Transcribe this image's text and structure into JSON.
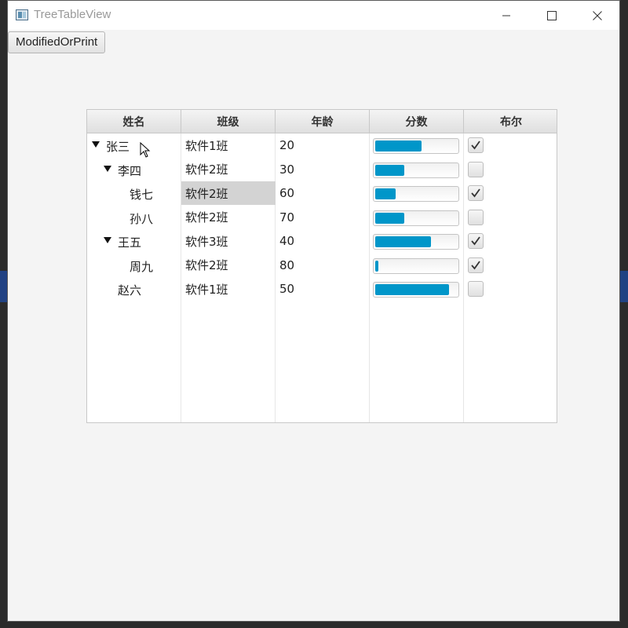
{
  "window": {
    "title": "TreeTableView"
  },
  "toolbar": {
    "button_label": "ModifiedOrPrint"
  },
  "table": {
    "columns": [
      "姓名",
      "班级",
      "年龄",
      "分数",
      "布尔"
    ],
    "rows": [
      {
        "name": "张三",
        "class": "软件1班",
        "age": "20",
        "score": 0.57,
        "checked": true
      },
      {
        "name": "李四",
        "class": "软件2班",
        "age": "30",
        "score": 0.36,
        "checked": false
      },
      {
        "name": "钱七",
        "class": "软件2班",
        "age": "60",
        "score": 0.25,
        "checked": true
      },
      {
        "name": "孙八",
        "class": "软件2班",
        "age": "70",
        "score": 0.36,
        "checked": false
      },
      {
        "name": "王五",
        "class": "软件3班",
        "age": "40",
        "score": 0.68,
        "checked": true
      },
      {
        "name": "周九",
        "class": "软件2班",
        "age": "80",
        "score": 0.04,
        "checked": true
      },
      {
        "name": "赵六",
        "class": "软件1班",
        "age": "50",
        "score": 0.9,
        "checked": false
      }
    ],
    "expanded_rows": [
      "张三",
      "李四",
      "王五"
    ],
    "selected_cell": "钱七 / 班级"
  },
  "colors": {
    "accent": "#0096c9",
    "selection": "#d3d3d3"
  }
}
